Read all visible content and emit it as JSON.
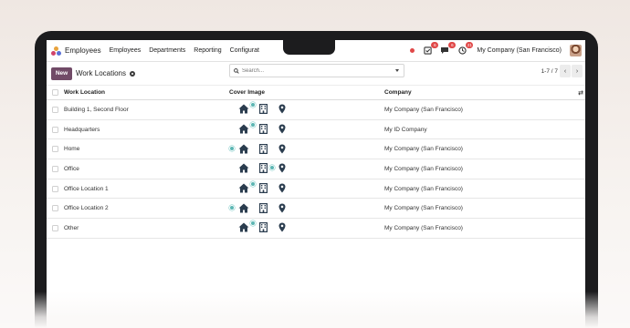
{
  "topnav": {
    "app_name": "Employees",
    "menu": [
      "Employees",
      "Departments",
      "Reporting",
      "Configurat"
    ],
    "badges": {
      "activity": "6",
      "messages": "6",
      "clock": "21"
    },
    "company": "My Company (San Francisco)"
  },
  "control": {
    "new_label": "New",
    "breadcrumb": "Work Locations",
    "search_placeholder": "Search...",
    "pager": "1-7 / 7"
  },
  "table": {
    "columns": [
      "Work Location",
      "Cover Image",
      "Company"
    ],
    "rows": [
      {
        "name": "Building 1, Second Floor",
        "cover": "office",
        "company": "My Company (San Francisco)"
      },
      {
        "name": "Headquarters",
        "cover": "office",
        "company": "My ID Company"
      },
      {
        "name": "Home",
        "cover": "home",
        "company": "My Company (San Francisco)"
      },
      {
        "name": "Office",
        "cover": "none",
        "company": "My Company (San Francisco)"
      },
      {
        "name": "Office Location 1",
        "cover": "office",
        "company": "My Company (San Francisco)"
      },
      {
        "name": "Office Location 2",
        "cover": "home",
        "company": "My Company (San Francisco)"
      },
      {
        "name": "Other",
        "cover": "office",
        "company": "My Company (San Francisco)"
      }
    ]
  },
  "colors": {
    "brand": "#714b67",
    "badge": "#e04848",
    "selected_dot": "#5bb6b3",
    "icon": "#2b3d4f"
  }
}
